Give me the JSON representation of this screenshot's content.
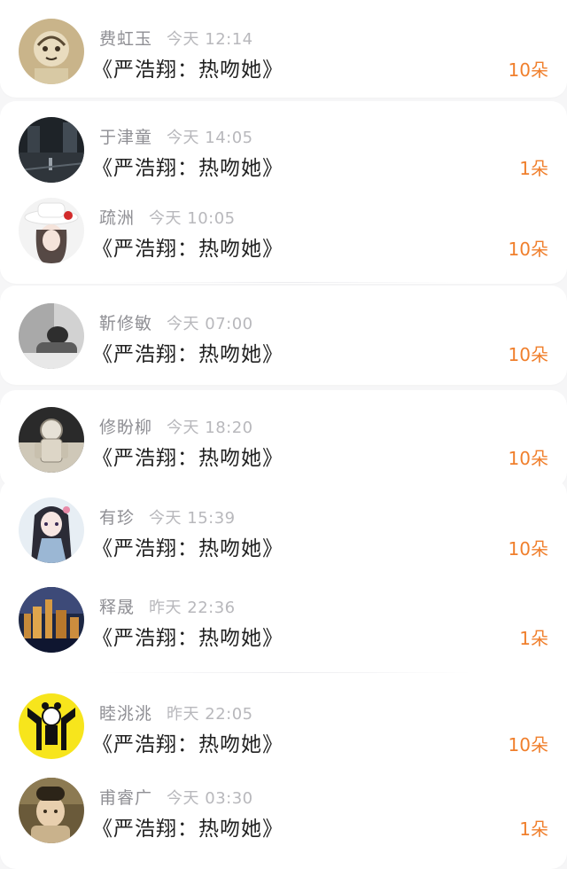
{
  "rows": [
    {
      "name": "费虹玉",
      "time": "今天 12:14",
      "message": "《严浩翔：热吻她》",
      "count": "10朵",
      "avatar_icon": "illustrated-girl-avatar"
    },
    {
      "name": "于津童",
      "time": "今天 14:05",
      "message": "《严浩翔：热吻她》",
      "count": "1朵",
      "avatar_icon": "dark-street-avatar"
    },
    {
      "name": "疏洲",
      "time": "今天 10:05",
      "message": "《严浩翔：热吻她》",
      "count": "10朵",
      "avatar_icon": "girl-white-hat-avatar"
    },
    {
      "name": "靳修敏",
      "time": "今天 07:00",
      "message": "《严浩翔：热吻她》",
      "count": "10朵",
      "avatar_icon": "monochrome-couple-avatar"
    },
    {
      "name": "修盼柳",
      "time": "今天 18:20",
      "message": "《严浩翔：热吻她》",
      "count": "10朵",
      "avatar_icon": "astronaut-avatar"
    },
    {
      "name": "有珍",
      "time": "今天 15:39",
      "message": "《严浩翔：热吻她》",
      "count": "10朵",
      "avatar_icon": "anime-girl-avatar"
    },
    {
      "name": "释晟",
      "time": "昨天 22:36",
      "message": "《严浩翔：热吻她》",
      "count": "1朵",
      "avatar_icon": "city-night-avatar"
    },
    {
      "name": "睦洮洮",
      "time": "昨天 22:05",
      "message": "《严浩翔：热吻她》",
      "count": "10朵",
      "avatar_icon": "yellow-cartoon-avatar"
    },
    {
      "name": "甫睿广",
      "time": "今天 03:30",
      "message": "《严浩翔：热吻她》",
      "count": "1朵",
      "avatar_icon": "blurry-photo-avatar"
    }
  ],
  "colors": {
    "name": "#8f8f94",
    "time": "#b8b8bc",
    "message": "#222222",
    "count": "#f07f2c",
    "background": "#f6f6f7",
    "card": "#ffffff"
  }
}
